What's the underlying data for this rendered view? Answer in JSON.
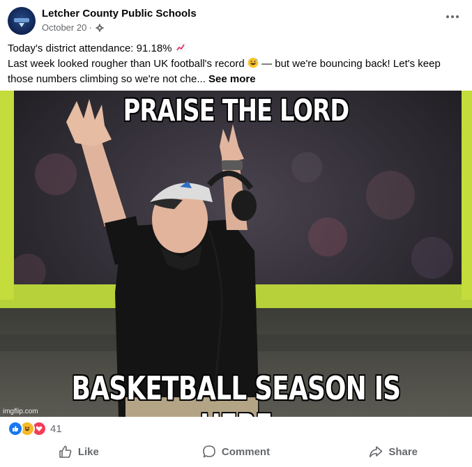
{
  "post": {
    "page_name": "Letcher County Public Schools",
    "date": "October 20",
    "separator": "·",
    "more_icon": "more-horizontal-icon",
    "audience_icon": "gear-icon"
  },
  "caption": {
    "line1": "Today's district attendance: 91.18%",
    "line1_emoji": "chart-increasing-icon",
    "line2_a": "Last week looked rougher than UK football's record",
    "line2_emoji": "grinning-sweat-icon",
    "line2_b": " — but we're bouncing back! Let's keep",
    "line3": "those numbers climbing so we're not che...",
    "see_more": "See more"
  },
  "image": {
    "top_text": "PRAISE THE LORD",
    "bottom_text": "BASKETBALL SEASON IS HERE",
    "watermark": "imgflip.com"
  },
  "reactions": {
    "icons": [
      "like-icon",
      "haha-icon",
      "love-icon"
    ],
    "count": "41"
  },
  "actions": {
    "like": "Like",
    "comment": "Comment",
    "share": "Share"
  },
  "colors": {
    "text": "#050505",
    "secondary": "#65676b",
    "like_blue": "#1877f2",
    "love_red": "#f33e58",
    "haha_yellow": "#f7b928"
  }
}
